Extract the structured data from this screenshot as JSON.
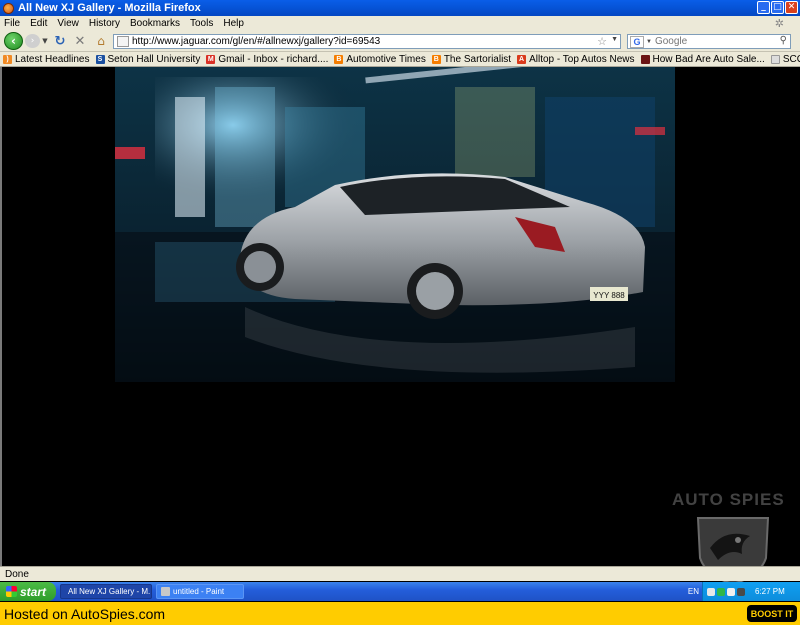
{
  "window": {
    "title": "All New XJ Gallery - Mozilla Firefox",
    "controls": {
      "minimize": "_",
      "maximize": "□",
      "close": "✕"
    }
  },
  "menu": [
    "File",
    "Edit",
    "View",
    "History",
    "Bookmarks",
    "Tools",
    "Help"
  ],
  "nav": {
    "url": "http://www.jaguar.com/gl/en/#/allnewxj/gallery?id=69543",
    "search_placeholder": "Google",
    "icons": [
      "back-arrow-icon",
      "forward-arrow-icon",
      "reload-icon",
      "stop-icon",
      "home-icon",
      "star-icon",
      "search-icon"
    ]
  },
  "bookmarks": [
    {
      "label": "Latest Headlines",
      "icon": "rss-icon",
      "color": "#f08a24"
    },
    {
      "label": "Seton Hall University",
      "icon": "shu-icon",
      "color": "#1a4fa0"
    },
    {
      "label": "Gmail - Inbox - richard....",
      "icon": "gmail-icon",
      "color": "#d93025"
    },
    {
      "label": "Automotive Times",
      "icon": "blogger-icon",
      "color": "#f57d00"
    },
    {
      "label": "The Sartorialist",
      "icon": "blogger-icon",
      "color": "#f57d00"
    },
    {
      "label": "Alltop - Top Autos News",
      "icon": "alltop-icon",
      "color": "#d93a1b"
    },
    {
      "label": "How Bad Are Auto Sale...",
      "icon": "page-icon",
      "color": "#6b1414"
    },
    {
      "label": "SCOUTING NY - www.s...",
      "icon": "page-icon",
      "color": "#cccccc"
    }
  ],
  "status": {
    "text": "Done"
  },
  "taskbar": {
    "start_label": "start",
    "tasks": [
      {
        "label": "All New XJ Gallery - M...",
        "active": true
      },
      {
        "label": "untitled - Paint",
        "active": false
      }
    ],
    "language": "EN",
    "clock": "6:27 PM"
  },
  "watermark": {
    "text": "AUTO SPIES"
  },
  "footer": {
    "hosted": "Hosted on AutoSpies.com",
    "boost": "BOOST IT"
  },
  "photo": {
    "plate": "YYY 888"
  }
}
